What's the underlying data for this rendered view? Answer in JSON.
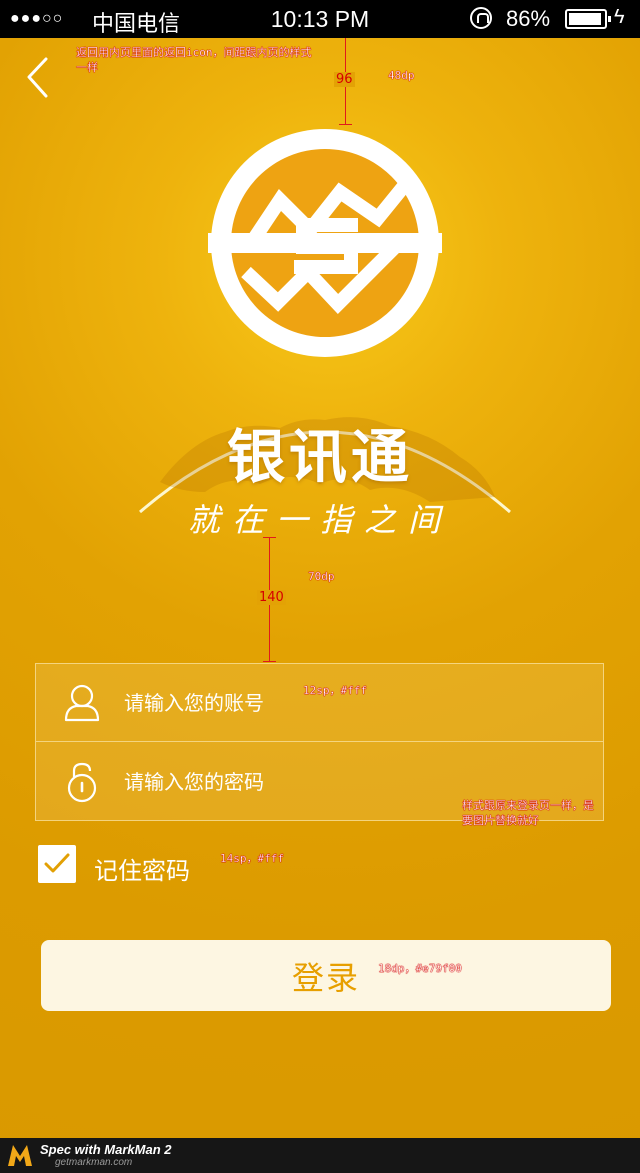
{
  "status_bar": {
    "signal": "●●●○○",
    "carrier": "中国电信",
    "time": "10:13 PM",
    "battery_percent": "86%"
  },
  "brand": {
    "title": "银讯通",
    "slogan": "就在一指之间"
  },
  "form": {
    "account_placeholder": "请输入您的账号",
    "password_placeholder": "请输入您的密码",
    "remember_label": "记住密码",
    "remember_checked": true,
    "login_label": "登录"
  },
  "colors": {
    "background": "#dc9c00",
    "login_text": "#e79f00",
    "login_bg": "#fdf6e2",
    "annotation": "#d60000"
  },
  "annotations": {
    "back_note": "返回用内页里面的返回icon，间距跟内页的样式一样",
    "top_spacing_px": "96",
    "top_spacing_dp": "48dp",
    "form_spacing_px": "140",
    "form_spacing_dp": "70dp",
    "input_font": "12sp，#fff",
    "form_style_note": "样式跟原来登录页一样，是要图片替换就好",
    "remember_font": "14sp，#fff",
    "login_font": "18dp，#e79f00"
  },
  "footer": {
    "brand": "Spec with MarkMan 2",
    "url": "getmarkman.com"
  }
}
